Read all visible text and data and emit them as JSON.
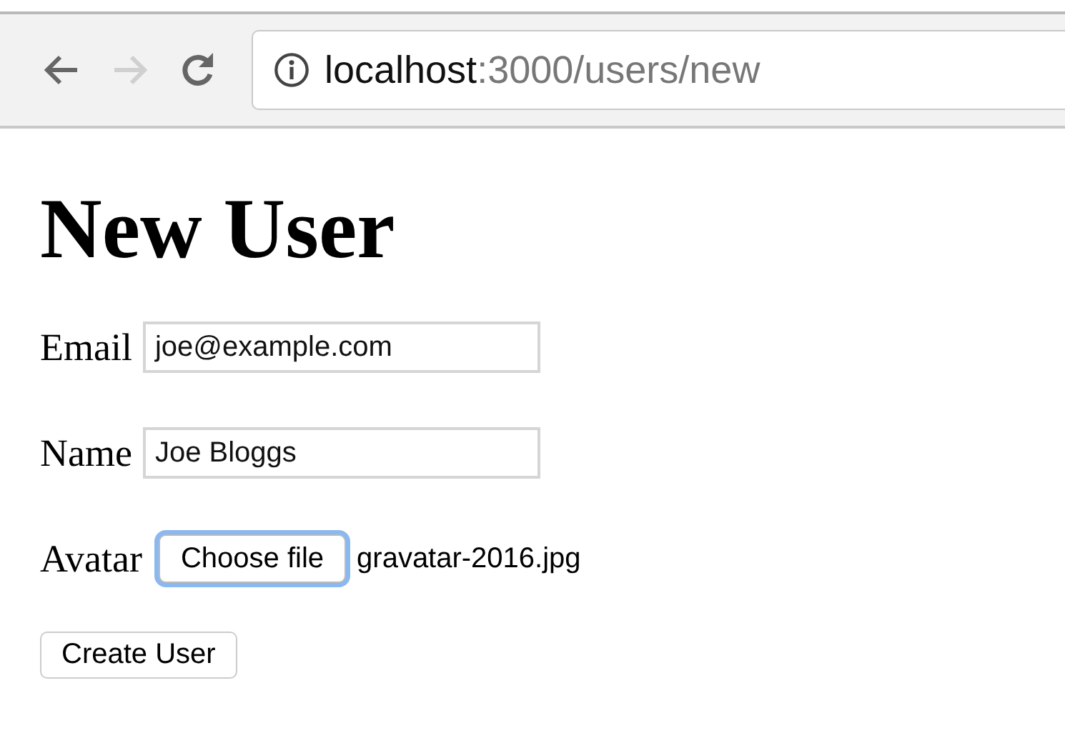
{
  "toolbar": {
    "back": {
      "disabled": false
    },
    "forward": {
      "disabled": true
    },
    "address": {
      "host": "localhost",
      "path": ":3000/users/new"
    }
  },
  "heading": "New User",
  "fields": [
    {
      "kind": "text",
      "label": "Email",
      "value": "joe@example.com"
    },
    {
      "kind": "text",
      "label": "Name",
      "value": "Joe Bloggs"
    },
    {
      "kind": "file",
      "label": "Avatar",
      "button": "Choose file",
      "filename": "gravatar-2016.jpg",
      "focused": true
    }
  ],
  "submit": "Create User"
}
